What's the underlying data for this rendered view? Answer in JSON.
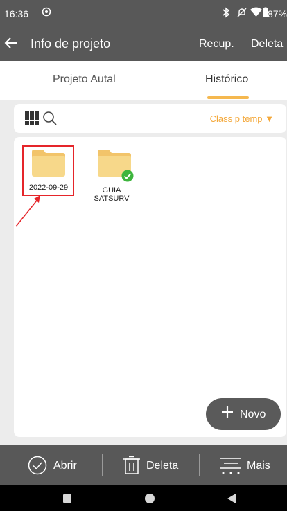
{
  "status_bar": {
    "time": "16:36",
    "battery": "87%",
    "icons": [
      "notification-icon",
      "bluetooth-icon",
      "mute-icon",
      "wifi-icon",
      "battery-icon"
    ]
  },
  "toolbar": {
    "title": "Info de projeto",
    "recover_label": "Recup.",
    "delete_label": "Deleta"
  },
  "tabs": [
    {
      "label": "Projeto Autal",
      "active": false
    },
    {
      "label": "Histórico",
      "active": true
    }
  ],
  "filter": {
    "sort_label": "Class p temp ▼"
  },
  "files": [
    {
      "name": "2022-09-29",
      "selected": true,
      "status": "none"
    },
    {
      "name_line1": "GUIA",
      "name_line2": "SATSURV",
      "selected": false,
      "status": "checked"
    }
  ],
  "fab": {
    "label": "Novo"
  },
  "bottom_bar": {
    "open_label": "Abrir",
    "delete_label": "Deleta",
    "more_label": "Mais"
  },
  "colors": {
    "bar": "#585858",
    "accent": "#f4a83a",
    "folder": "#f7d88a",
    "check": "#3db53d",
    "highlight": "#e5252a"
  }
}
